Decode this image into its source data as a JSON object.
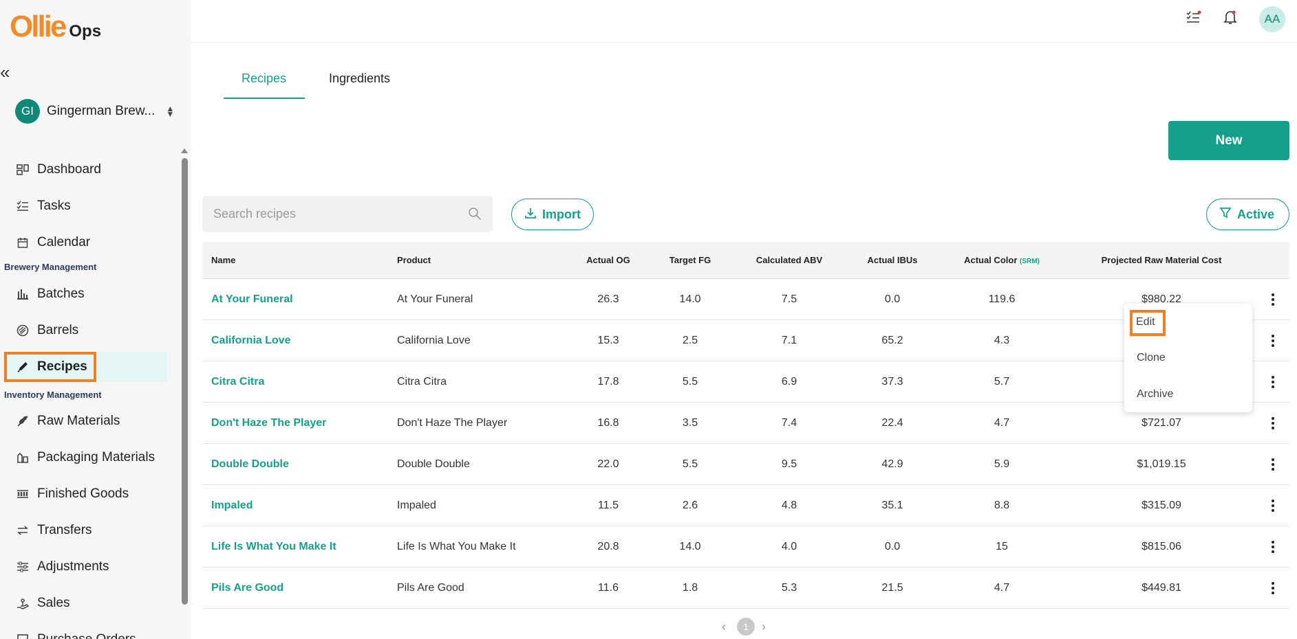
{
  "app": {
    "logo_main": "Ollie",
    "logo_sub": "Ops"
  },
  "header": {
    "avatar_initials": "AA"
  },
  "org": {
    "initials": "GI",
    "name": "Gingerman Brew..."
  },
  "sidebar": {
    "items": [
      {
        "label": "Dashboard",
        "icon": "dashboard-icon"
      },
      {
        "label": "Tasks",
        "icon": "tasks-icon"
      },
      {
        "label": "Calendar",
        "icon": "calendar-icon"
      },
      {
        "label": "Batches",
        "icon": "batches-icon"
      },
      {
        "label": "Barrels",
        "icon": "barrels-icon"
      },
      {
        "label": "Recipes",
        "icon": "recipes-icon"
      },
      {
        "label": "Raw Materials",
        "icon": "raw-materials-icon"
      },
      {
        "label": "Packaging Materials",
        "icon": "packaging-icon"
      },
      {
        "label": "Finished Goods",
        "icon": "finished-goods-icon"
      },
      {
        "label": "Transfers",
        "icon": "transfers-icon"
      },
      {
        "label": "Adjustments",
        "icon": "adjustments-icon"
      },
      {
        "label": "Sales",
        "icon": "sales-icon"
      },
      {
        "label": "Purchase Orders",
        "icon": "purchase-orders-icon"
      }
    ],
    "sections": {
      "brewery": "Brewery Management",
      "inventory": "Inventory Management"
    },
    "active": "Recipes"
  },
  "tabs": {
    "recipes": "Recipes",
    "ingredients": "Ingredients"
  },
  "toolbar": {
    "new_label": "New",
    "search_placeholder": "Search recipes",
    "import_label": "Import",
    "filter_label": "Active"
  },
  "table": {
    "headers": {
      "name": "Name",
      "product": "Product",
      "og": "Actual OG",
      "fg": "Target FG",
      "abv": "Calculated ABV",
      "ibu": "Actual IBUs",
      "color": "Actual Color",
      "color_unit": "(SRM)",
      "cost": "Projected Raw Material Cost"
    },
    "rows": [
      {
        "name": "At Your Funeral",
        "product": "At Your Funeral",
        "og": "26.3",
        "fg": "14.0",
        "abv": "7.5",
        "ibu": "0.0",
        "color": "119.6",
        "cost": "$980.22"
      },
      {
        "name": "California Love",
        "product": "California Love",
        "og": "15.3",
        "fg": "2.5",
        "abv": "7.1",
        "ibu": "65.2",
        "color": "4.3",
        "cost": ""
      },
      {
        "name": "Citra Citra",
        "product": "Citra Citra",
        "og": "17.8",
        "fg": "5.5",
        "abv": "6.9",
        "ibu": "37.3",
        "color": "5.7",
        "cost": ""
      },
      {
        "name": "Don't Haze The Player",
        "product": "Don't Haze The Player",
        "og": "16.8",
        "fg": "3.5",
        "abv": "7.4",
        "ibu": "22.4",
        "color": "4.7",
        "cost": "$721.07"
      },
      {
        "name": "Double Double",
        "product": "Double Double",
        "og": "22.0",
        "fg": "5.5",
        "abv": "9.5",
        "ibu": "42.9",
        "color": "5.9",
        "cost": "$1,019.15"
      },
      {
        "name": "Impaled",
        "product": "Impaled",
        "og": "11.5",
        "fg": "2.6",
        "abv": "4.8",
        "ibu": "35.1",
        "color": "8.8",
        "cost": "$315.09"
      },
      {
        "name": "Life Is What You Make It",
        "product": "Life Is What You Make It",
        "og": "20.8",
        "fg": "14.0",
        "abv": "4.0",
        "ibu": "0.0",
        "color": "15",
        "cost": "$815.06"
      },
      {
        "name": "Pils Are Good",
        "product": "Pils Are Good",
        "og": "11.6",
        "fg": "1.8",
        "abv": "5.3",
        "ibu": "21.5",
        "color": "4.7",
        "cost": "$449.81"
      }
    ]
  },
  "row_menu": {
    "edit": "Edit",
    "clone": "Clone",
    "archive": "Archive"
  },
  "pagination": {
    "current": "1"
  },
  "colors": {
    "accent": "#14a08a",
    "highlight": "#f07f24",
    "logo": "#f28c28"
  }
}
